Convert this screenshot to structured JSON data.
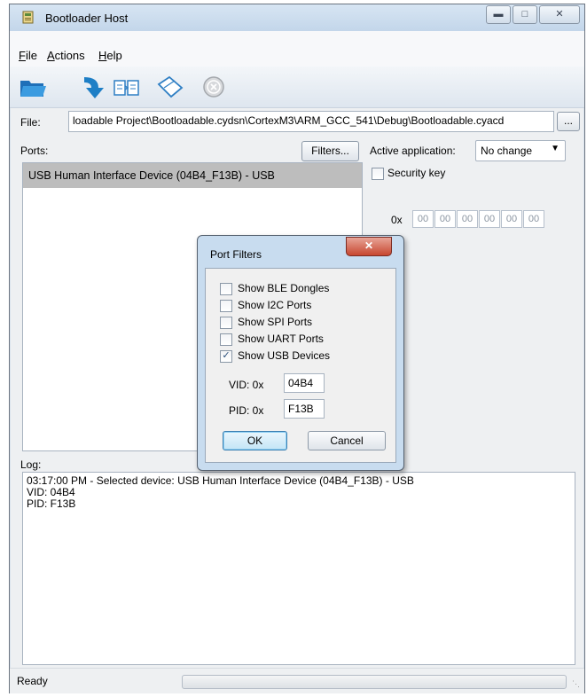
{
  "window": {
    "title": "Bootloader Host",
    "icon": "app-icon"
  },
  "caption_buttons": {
    "minimize": "minimize-icon",
    "maximize": "maximize-icon",
    "close": "close-icon"
  },
  "menu": [
    {
      "label": "File",
      "mnemonic": "F",
      "rest": "ile"
    },
    {
      "label": "Actions",
      "mnemonic": "A",
      "rest": "ctions"
    },
    {
      "label": "Help",
      "mnemonic": "H",
      "rest": "elp"
    }
  ],
  "toolbar": {
    "icons": [
      "open-folder-icon",
      "program-arrow-icon",
      "verify-icon",
      "erase-icon",
      "abort-icon"
    ]
  },
  "file": {
    "label": "File:",
    "path": "loadable Project\\Bootloadable.cydsn\\CortexM3\\ARM_GCC_541\\Debug\\Bootloadable.cyacd",
    "browse_label": "..."
  },
  "ports": {
    "label": "Ports:",
    "filters_label": "Filters...",
    "items": [
      "USB Human Interface Device (04B4_F13B) - USB"
    ]
  },
  "active_application": {
    "label": "Active application:",
    "value": "No change"
  },
  "security_key": {
    "label": "Security key",
    "prefix": "0x",
    "bytes": [
      "00",
      "00",
      "00",
      "00",
      "00",
      "00"
    ]
  },
  "log": {
    "label": "Log:",
    "lines": [
      "03:17:00 PM - Selected device: USB Human Interface Device (04B4_F13B) - USB",
      "VID: 04B4",
      "PID: F13B"
    ]
  },
  "status": {
    "text": "Ready"
  },
  "port_filters": {
    "title": "Port Filters",
    "options": [
      {
        "label": "Show BLE Dongles",
        "checked": false
      },
      {
        "label": "Show I2C Ports",
        "checked": false
      },
      {
        "label": "Show SPI Ports",
        "checked": false
      },
      {
        "label": "Show UART Ports",
        "checked": false
      },
      {
        "label": "Show USB Devices",
        "checked": true
      }
    ],
    "vid_label": "VID: 0x",
    "vid_value": "04B4",
    "pid_label": "PID: 0x",
    "pid_value": "F13B",
    "ok_label": "OK",
    "cancel_label": "Cancel"
  }
}
